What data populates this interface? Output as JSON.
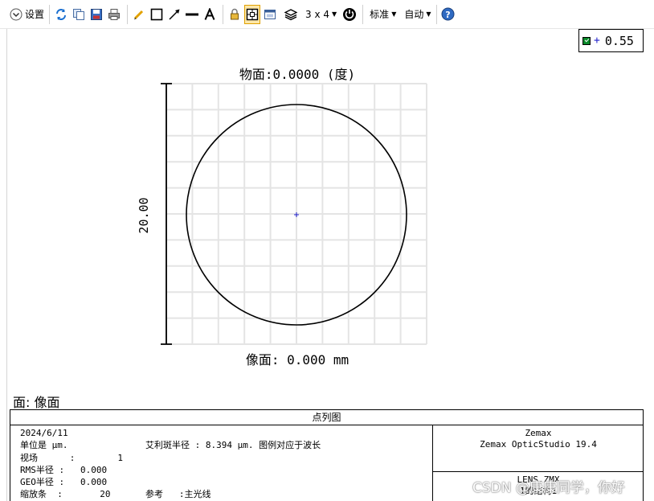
{
  "toolbar": {
    "settings_label": "设置",
    "layout_label": "3 x 4",
    "standard_label": "标准",
    "auto_label": "自动"
  },
  "legend": {
    "wavelength": "0.55"
  },
  "plot": {
    "object_title": "物面:0.0000 (度)",
    "image_title": "像面: 0.000 mm",
    "scale_label": "20.00"
  },
  "surface_label": "面: 像面",
  "info": {
    "title": "点列图",
    "date": "2024/6/11",
    "units": "单位是 µm.",
    "field_label": "视场",
    "field_colon": ":",
    "field_value": "1",
    "rms_label": "RMS半径 :",
    "rms_value": "0.000",
    "geo_label": "GEO半径 :",
    "geo_value": "0.000",
    "scale_bar_label": "缩放条  :",
    "scale_bar_value": "20",
    "airy_text": "艾利斑半径 : 8.394 µm. 图例对应于波长",
    "reference_label": "参考",
    "reference_value": ":主光线",
    "company": "Zemax",
    "product": "Zemax OpticStudio 19.4",
    "lens_file": "LENS.ZMX",
    "config": "1的结构1"
  },
  "watermark": "CSDN @康康同学，你好",
  "colors": {
    "grid": "#e4e4e4",
    "circle": "#000000",
    "chief_ray_marker": "#2222cc",
    "legend_swatch": "#0a8a2a",
    "active_tool": "#fde7a8"
  }
}
